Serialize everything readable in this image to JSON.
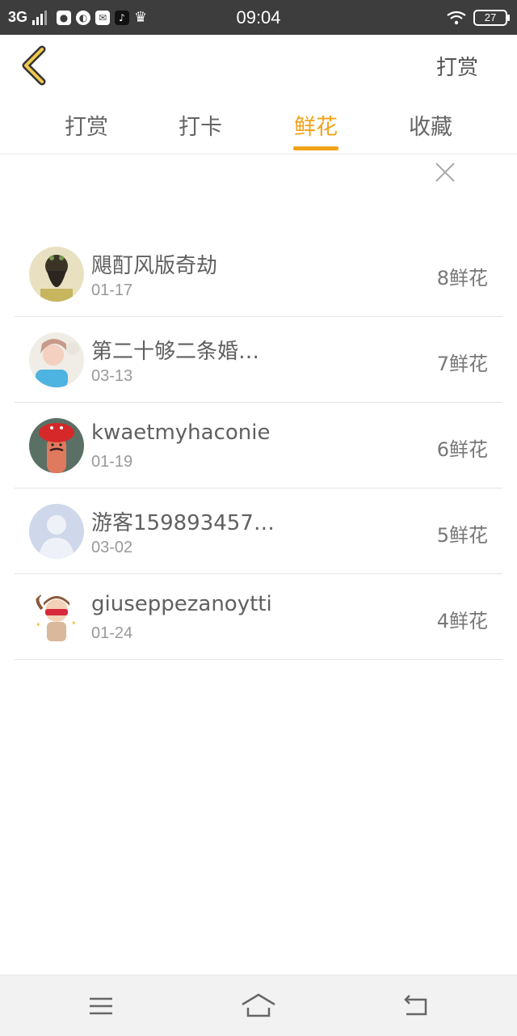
{
  "status_bar": {
    "network": "3G",
    "time": "09:04",
    "battery": "27",
    "app_icons": [
      "wechat-icon",
      "browser-icon",
      "message-icon",
      "tiktok-icon",
      "crown-icon"
    ]
  },
  "header": {
    "action_label": "打赏"
  },
  "tabs": [
    {
      "label": "打赏"
    },
    {
      "label": "打卡"
    },
    {
      "label": "鲜花"
    },
    {
      "label": "收藏"
    }
  ],
  "active_tab": "鲜花",
  "list": [
    {
      "name": "飓酊风版奇劫",
      "date": "01-17",
      "flowers": "8鲜花"
    },
    {
      "name": "第二十够二条婚…",
      "date": "03-13",
      "flowers": "7鲜花"
    },
    {
      "name": "kwaetmyhaconie",
      "date": "01-19",
      "flowers": "6鲜花"
    },
    {
      "name": "游客159893457…",
      "date": "03-02",
      "flowers": "5鲜花"
    },
    {
      "name": "giuseppezanoytti",
      "date": "01-24",
      "flowers": "4鲜花"
    }
  ],
  "colors": {
    "accent": "#f0a318",
    "status_bar": "#3d3d3d",
    "nav_bar": "#f2f2f2"
  }
}
